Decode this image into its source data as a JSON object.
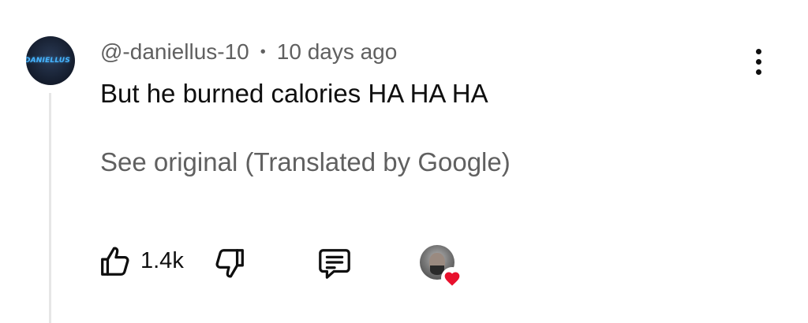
{
  "comment": {
    "author_handle": "@-daniellus-10",
    "separator": "•",
    "posted_ago": "10 days ago",
    "text": "But he burned calories HA HA HA",
    "translation_link": "See original (Translated by Google)",
    "avatar_text": "DANIELLUS"
  },
  "actions": {
    "like_count": "1.4k",
    "like_icon": "thumbs-up-icon",
    "dislike_icon": "thumbs-down-icon",
    "reply_icon": "comment-icon",
    "more_icon": "more-vertical-icon"
  },
  "colors": {
    "primary_text": "#0f0f0f",
    "secondary_text": "#606060",
    "heart": "#e8112d",
    "thread_line": "#e6e6e6",
    "avatar_accent": "#46b4ff"
  }
}
